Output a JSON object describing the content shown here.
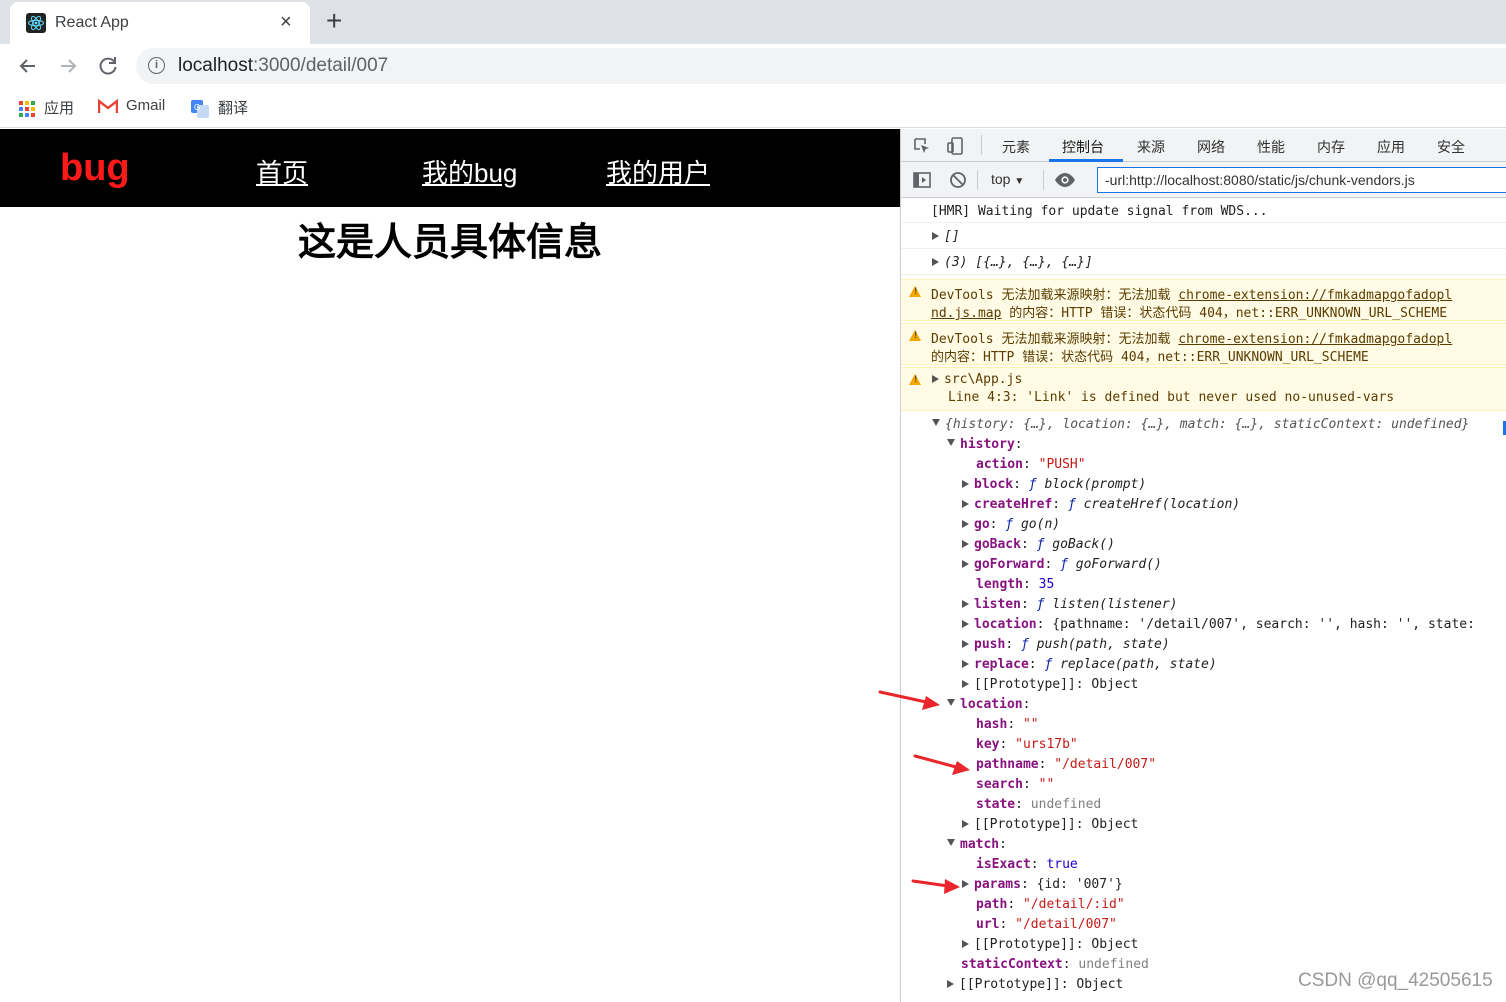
{
  "browser": {
    "tab_title": "React App",
    "tab_close": "×",
    "new_tab": "+",
    "url_host": "localhost",
    "url_path": ":3000/detail/007",
    "bookmarks": [
      {
        "label": "应用",
        "icon": "apps-grid-icon"
      },
      {
        "label": "Gmail",
        "icon": "gmail-icon"
      },
      {
        "label": "翻译",
        "icon": "translate-icon"
      }
    ]
  },
  "page": {
    "brand": "bug",
    "nav": [
      "首页",
      "我的bug",
      "我的用户"
    ],
    "heading": "这是人员具体信息"
  },
  "devtools": {
    "tabs": [
      "元素",
      "控制台",
      "来源",
      "网络",
      "性能",
      "内存",
      "应用",
      "安全"
    ],
    "active_tab": "控制台",
    "context": "top",
    "filter_value": "-url:http://localhost:8080/static/js/chunk-vendors.js",
    "console": {
      "l1": "[HMR] Waiting for update signal from WDS...",
      "l2": "[]",
      "l3": "(3) [{…}, {…}, {…}]",
      "w1a_pre": "DevTools 无法加载来源映射：无法加载 ",
      "w1a_link": "chrome-extension://fmkadmapgofadopl",
      "w1b_link": "nd.js.map",
      "w1b_post": " 的内容：HTTP 错误：状态代码 404，net::ERR_UNKNOWN_URL_SCHEME",
      "w2a_pre": "DevTools 无法加载来源映射：无法加载 ",
      "w2a_link": "chrome-extension://fmkadmapgofadopl",
      "w2b": "的内容：HTTP 错误：状态代码 404，net::ERR_UNKNOWN_URL_SCHEME",
      "w3a": "src\\App.js",
      "w3b": "Line 4:3:  'Link' is defined but never used  no-unused-vars",
      "obj_summary": "{history: {…}, location: {…}, match: {…}, staticContext: undefined}",
      "history_key": "history",
      "history_items": [
        {
          "expand": false,
          "key": "action",
          "value": "\"PUSH\"",
          "type": "str"
        },
        {
          "expand": true,
          "key": "block",
          "value": "block(prompt)",
          "type": "fn"
        },
        {
          "expand": true,
          "key": "createHref",
          "value": "createHref(location)",
          "type": "fn"
        },
        {
          "expand": true,
          "key": "go",
          "value": "go(n)",
          "type": "fn"
        },
        {
          "expand": true,
          "key": "goBack",
          "value": "goBack()",
          "type": "fn"
        },
        {
          "expand": true,
          "key": "goForward",
          "value": "goForward()",
          "type": "fn"
        },
        {
          "expand": false,
          "key": "length",
          "value": "35",
          "type": "num"
        },
        {
          "expand": true,
          "key": "listen",
          "value": "listen(listener)",
          "type": "fn"
        },
        {
          "expand": true,
          "key": "location",
          "value": "{pathname: '/detail/007', search: '', hash: '', state:",
          "type": "obj"
        },
        {
          "expand": true,
          "key": "push",
          "value": "push(path, state)",
          "type": "fn"
        },
        {
          "expand": true,
          "key": "replace",
          "value": "replace(path, state)",
          "type": "fn"
        },
        {
          "expand": true,
          "key": "[[Prototype]]",
          "value": "Object",
          "type": "proto"
        }
      ],
      "location_key": "location",
      "location_items": [
        {
          "expand": false,
          "key": "hash",
          "value": "\"\"",
          "type": "str"
        },
        {
          "expand": false,
          "key": "key",
          "value": "\"urs17b\"",
          "type": "str"
        },
        {
          "expand": false,
          "key": "pathname",
          "value": "\"/detail/007\"",
          "type": "str"
        },
        {
          "expand": false,
          "key": "search",
          "value": "\"\"",
          "type": "str"
        },
        {
          "expand": false,
          "key": "state",
          "value": "undefined",
          "type": "undef"
        },
        {
          "expand": true,
          "key": "[[Prototype]]",
          "value": "Object",
          "type": "proto"
        }
      ],
      "match_key": "match",
      "match_items": [
        {
          "expand": false,
          "key": "isExact",
          "value": "true",
          "type": "num"
        },
        {
          "expand": true,
          "key": "params",
          "value": "{id: '007'}",
          "type": "obj"
        },
        {
          "expand": false,
          "key": "path",
          "value": "\"/detail/:id\"",
          "type": "str"
        },
        {
          "expand": false,
          "key": "url",
          "value": "\"/detail/007\"",
          "type": "str"
        },
        {
          "expand": true,
          "key": "[[Prototype]]",
          "value": "Object",
          "type": "proto"
        }
      ],
      "static_key": "staticContext",
      "static_value": "undefined",
      "root_proto_key": "[[Prototype]]",
      "root_proto_value": "Object"
    }
  },
  "watermark": "CSDN @qq_42505615",
  "colors": {
    "brand": "#ff1a1a",
    "nav_bg": "#000000",
    "annotation_arrow": "#e8262b"
  }
}
